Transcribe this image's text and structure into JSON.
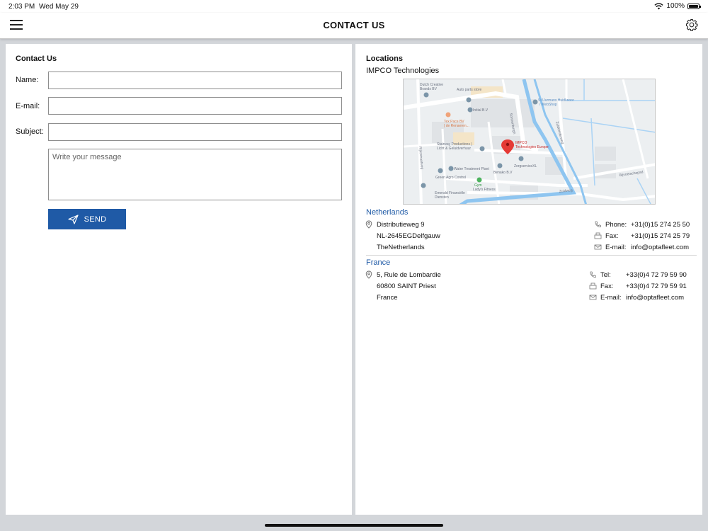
{
  "status": {
    "time": "2:03 PM",
    "date": "Wed May 29",
    "battery": "100%"
  },
  "header": {
    "title": "CONTACT US"
  },
  "contact_form": {
    "title": "Contact Us",
    "name_label": "Name:",
    "email_label": "E-mail:",
    "subject_label": "Subject:",
    "name_value": "",
    "email_value": "",
    "subject_value": "",
    "message_placeholder": "Write your message",
    "send_label": "SEND",
    "accent": "#1f5aa6"
  },
  "locations": {
    "title": "Locations",
    "company": "IMPCO Technologies",
    "map_labels": {
      "dutch_creative": "Dutch Creative",
      "brands": "Brands BV",
      "auto_parts": "Auto parts store",
      "initial": "Initial B.V",
      "stuurmanshuid": "St.Uurmans Huidknoor",
      "sw_window": "/ WebShop",
      "tex_pace": "Tex Pace BV",
      "tex_pace_sub": "| de Renaeren...",
      "stairway": "Stairway Productions |",
      "stairway_sub": "Licht & Geluidverhuur",
      "impco": "IMPCO",
      "impco_sub": "Technologies Europe",
      "zorgservice": "ZorgserviceXL",
      "water": "Water Treatment Plant",
      "green_agro": "Green Agro Control",
      "benako": "Benako B.V",
      "gym": "Gym",
      "gym_sub": "Lady's Fitness",
      "emerald": "Emerald Financiële",
      "emerald_sub": "Diensten",
      "road_a": "Rijksstraatweg",
      "road_b": "Zuidweg",
      "road_c": "Sonnenburgh",
      "road_d": "Zuideinderweg",
      "road_e": "Bijvoetschepad"
    },
    "offices": [
      {
        "country": "Netherlands",
        "address": [
          "Distributieweg 9",
          "NL-2645EGDelfgauw",
          "TheNetherlands"
        ],
        "contacts": [
          {
            "icon": "phone-icon",
            "label": "Phone:",
            "value": "+31(0)15 274 25 50"
          },
          {
            "icon": "fax-icon",
            "label": "Fax:",
            "value": "+31(0)15 274 25 79"
          },
          {
            "icon": "mail-icon",
            "label": "E-mail:",
            "value": "info@optafleet.com"
          }
        ]
      },
      {
        "country": "France",
        "address": [
          "5, Rule de Lombardie",
          "60800 SAINT Priest",
          "France"
        ],
        "contacts": [
          {
            "icon": "phone-icon",
            "label": "Tel:",
            "value": "+33(0)4 72 79 59 90"
          },
          {
            "icon": "fax-icon",
            "label": "Fax:",
            "value": "+33(0)4 72 79 59 91"
          },
          {
            "icon": "mail-icon",
            "label": "E-mail:",
            "value": "info@optafleet.com"
          }
        ]
      }
    ]
  }
}
